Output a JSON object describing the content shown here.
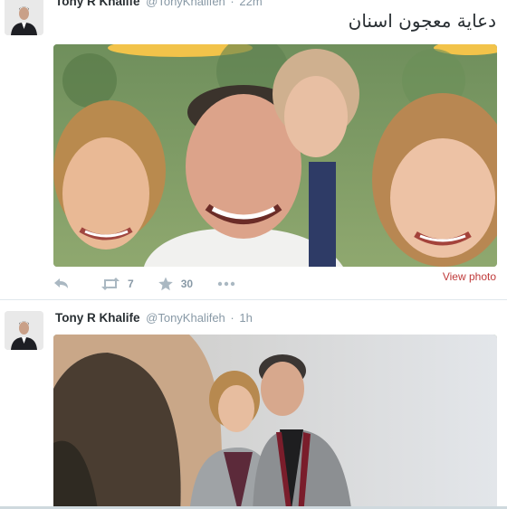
{
  "tweets": [
    {
      "author": {
        "name": "Tony R Khalife",
        "handle": "@TonyKhalifeh"
      },
      "separator": "·",
      "time": "22m",
      "text": "دعاية معجون اسنان",
      "media": {
        "description_icon": "selfie-photo",
        "link_label": "View photo"
      },
      "actions": {
        "reply_icon": "reply-icon",
        "retweet_icon": "retweet-icon",
        "retweet_count": "7",
        "favorite_icon": "star-icon",
        "favorite_count": "30",
        "more_icon": "more-icon"
      }
    },
    {
      "author": {
        "name": "Tony R Khalife",
        "handle": "@TonyKhalifeh"
      },
      "separator": "·",
      "time": "1h",
      "media": {
        "description_icon": "couple-photo"
      }
    }
  ],
  "colors": {
    "link_red": "#bf3a3a",
    "muted": "#8899a6",
    "icon_gray": "#aab8c2",
    "text": "#292f33"
  }
}
